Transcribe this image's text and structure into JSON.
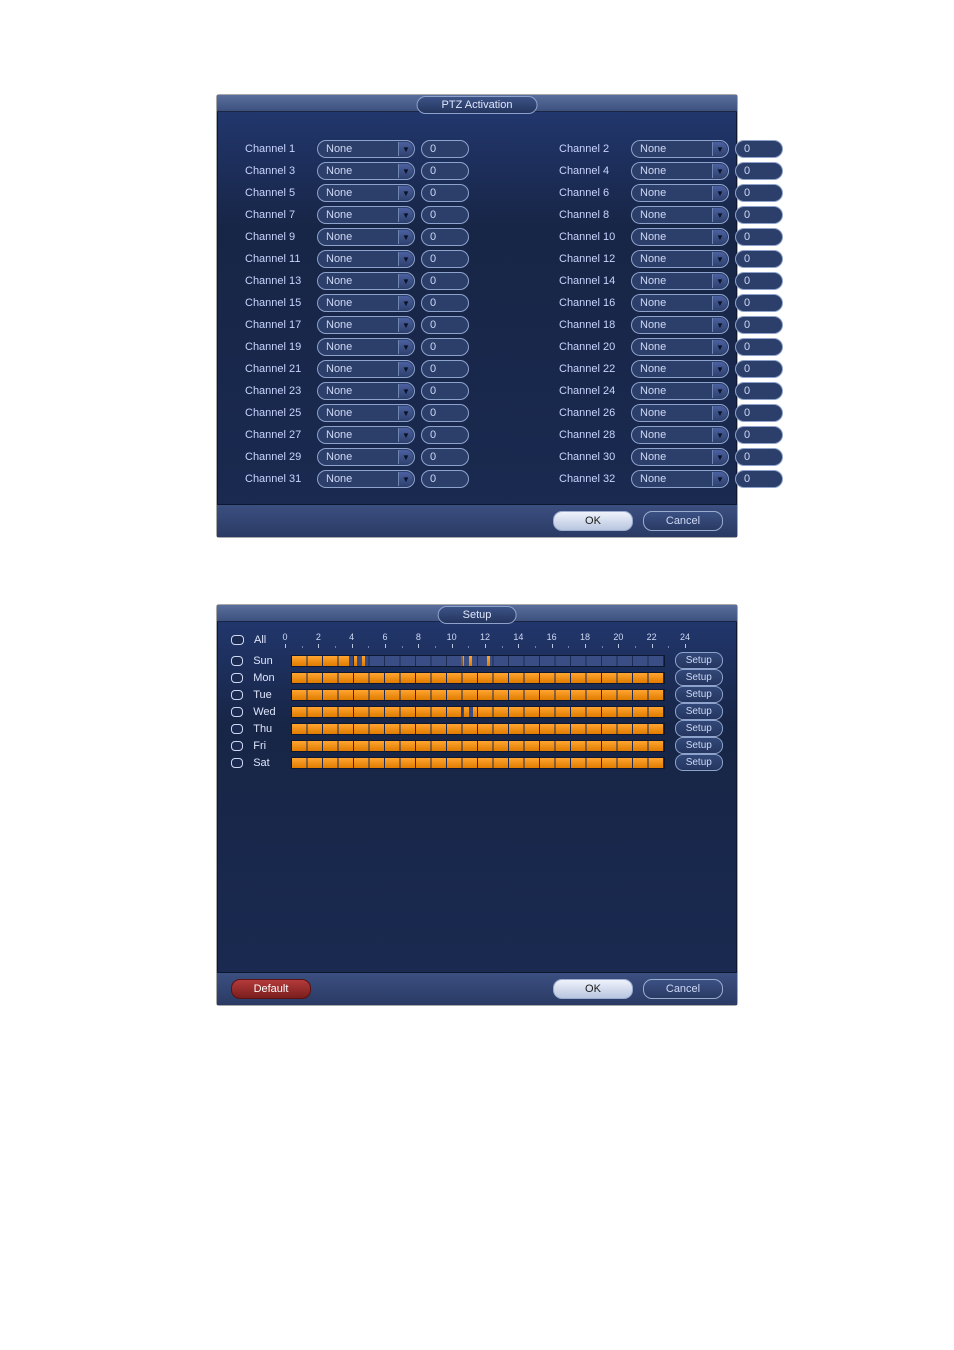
{
  "ptz": {
    "title": "PTZ Activation",
    "ok": "OK",
    "cancel": "Cancel",
    "dropdown_value": "None",
    "num_value": "0",
    "channels": [
      "Channel 1",
      "Channel 2",
      "Channel 3",
      "Channel 4",
      "Channel 5",
      "Channel 6",
      "Channel 7",
      "Channel 8",
      "Channel 9",
      "Channel 10",
      "Channel 11",
      "Channel 12",
      "Channel 13",
      "Channel 14",
      "Channel 15",
      "Channel 16",
      "Channel 17",
      "Channel 18",
      "Channel 19",
      "Channel 20",
      "Channel 21",
      "Channel 22",
      "Channel 23",
      "Channel 24",
      "Channel 25",
      "Channel 26",
      "Channel 27",
      "Channel 28",
      "Channel 29",
      "Channel 30",
      "Channel 31",
      "Channel 32"
    ]
  },
  "setup": {
    "title": "Setup",
    "default": "Default",
    "ok": "OK",
    "cancel": "Cancel",
    "setup_btn": "Setup",
    "all": "All",
    "days": [
      "Sun",
      "Mon",
      "Tue",
      "Wed",
      "Thu",
      "Fri",
      "Sat"
    ],
    "hour_labels": [
      "0",
      "2",
      "4",
      "6",
      "8",
      "10",
      "12",
      "14",
      "16",
      "18",
      "20",
      "22",
      "24"
    ],
    "segments": {
      "Sun": [
        [
          0,
          3.7
        ],
        [
          4.0,
          4.2
        ],
        [
          4.5,
          4.7
        ],
        [
          10.9,
          11.1
        ],
        [
          11.4,
          11.6
        ],
        [
          12.6,
          12.8
        ]
      ],
      "Mon": [
        [
          0,
          24
        ]
      ],
      "Tue": [
        [
          0,
          24
        ]
      ],
      "Wed": [
        [
          0,
          10.9
        ],
        [
          11.1,
          11.4
        ],
        [
          11.7,
          24
        ]
      ],
      "Thu": [
        [
          0,
          24
        ]
      ],
      "Fri": [
        [
          0,
          24
        ]
      ],
      "Sat": [
        [
          0,
          24
        ]
      ]
    }
  }
}
